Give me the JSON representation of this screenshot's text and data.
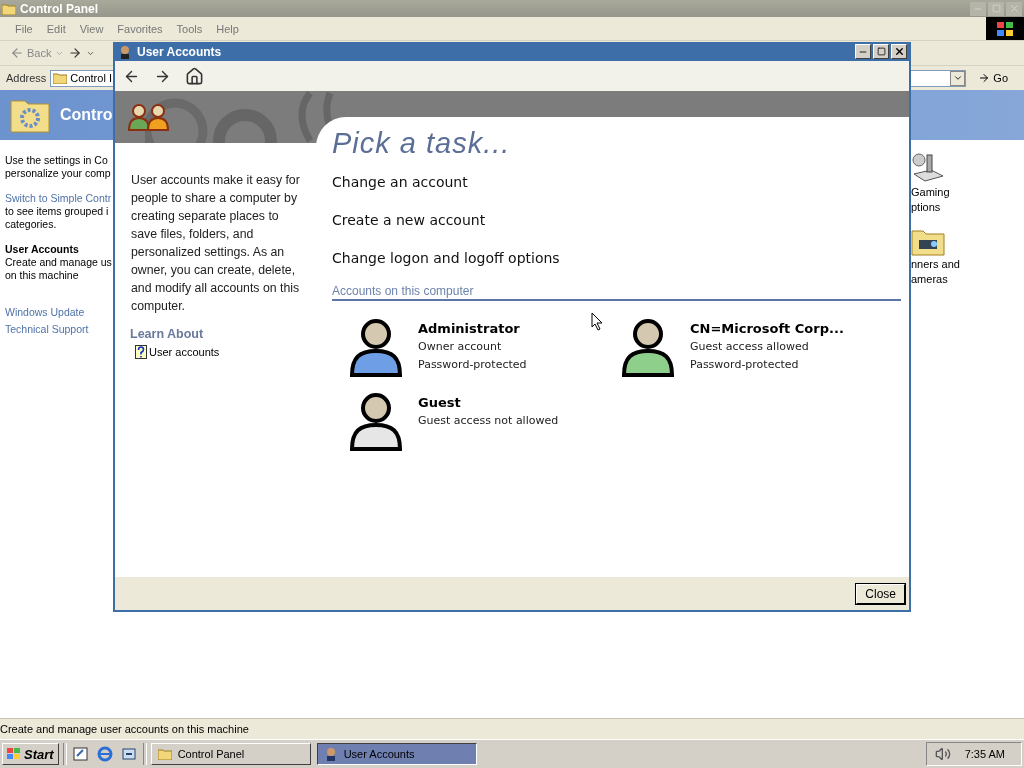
{
  "background_window": {
    "title": "Control Panel",
    "menu": [
      "File",
      "Edit",
      "View",
      "Favorites",
      "Tools",
      "Help"
    ],
    "toolbar": {
      "back": "Back"
    },
    "address": {
      "label": "Address",
      "value": "Control I",
      "go": "Go"
    },
    "header": "Contro",
    "left_pane": [
      {
        "parts": [
          {
            "kind": "text",
            "text": "Use the settings in Co"
          },
          {
            "kind": "text",
            "text": "personalize your comp"
          }
        ]
      },
      {
        "parts": [
          {
            "kind": "link",
            "text": "Switch to Simple Contr"
          },
          {
            "kind": "text",
            "text": "to see items grouped i"
          },
          {
            "kind": "text",
            "text": "categories."
          }
        ]
      },
      {
        "parts": [
          {
            "kind": "heading",
            "text": "User Accounts"
          },
          {
            "kind": "text",
            "text": "Create and manage us"
          },
          {
            "kind": "text",
            "text": "on this machine"
          }
        ]
      },
      {
        "parts": [
          {
            "kind": "link",
            "text": "Windows Update"
          },
          {
            "kind": "link",
            "text": "Technical Support"
          }
        ]
      }
    ],
    "right_items": [
      {
        "kind": "joystick",
        "lines": [
          "Gaming",
          "ptions"
        ]
      },
      {
        "kind": "camera",
        "lines": [
          "nners and",
          "ameras"
        ]
      }
    ],
    "status": "Create and manage user accounts on this machine"
  },
  "dialog": {
    "title": "User Accounts",
    "sidebar": {
      "description": "User accounts make it easy for people to share a computer by creating separate places to save files, folders, and personalized settings. As an owner, you can create, delete, and modify all accounts on this computer.",
      "learn_title": "Learn About",
      "links": [
        "User accounts"
      ]
    },
    "heading": "Pick a task...",
    "tasks": [
      "Change an account",
      "Create a new account",
      "Change logon and logoff options"
    ],
    "accounts_title": "Accounts on this computer",
    "accounts": [
      {
        "name": "Administrator",
        "lines": [
          "Owner account",
          "Password-protected"
        ],
        "color": "#6e9ee6"
      },
      {
        "name": "CN=Microsoft Corp...",
        "lines": [
          "Guest access allowed",
          "Password-protected"
        ],
        "color": "#8fcf8c"
      },
      {
        "name": "Guest",
        "lines": [
          "Guest access not allowed"
        ],
        "color": "#e6e6e6"
      }
    ],
    "close": "Close"
  },
  "taskbar": {
    "start": "Start",
    "tasks": [
      {
        "label": "Control Panel",
        "selected": false
      },
      {
        "label": "User Accounts",
        "selected": true
      }
    ],
    "clock": "7:35 AM"
  }
}
